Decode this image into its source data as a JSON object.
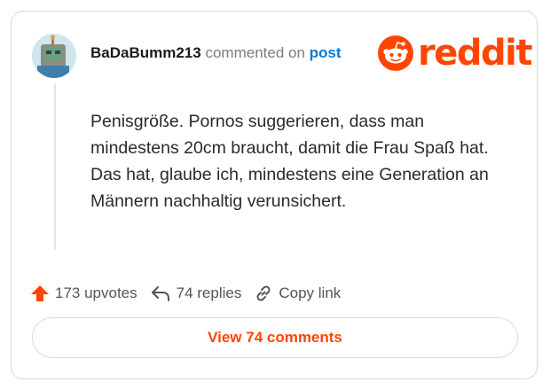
{
  "comment": {
    "username": "BaDaBumm213",
    "commented_on": "commented on",
    "post_link": "post",
    "body": "Penisgröße. Pornos suggerieren, dass man mindestens 20cm braucht, damit die Frau Spaß hat. Das hat, glaube ich, mindestens eine Generation an Männern nachhaltig verunsichert."
  },
  "brand": {
    "wordmark": "reddit",
    "color": "#ff4500",
    "icon": "reddit-snoo-icon"
  },
  "actions": {
    "upvotes": "173 upvotes",
    "replies": "74 replies",
    "copy_link": "Copy link"
  },
  "view_button": "View 74 comments",
  "icons": {
    "upvote": "upvote-arrow-icon",
    "reply": "reply-arrow-icon",
    "link": "link-icon"
  },
  "colors": {
    "accent": "#ff4500",
    "link": "#0079d3",
    "text": "#2b2b2b",
    "muted": "#7c7c7c"
  }
}
